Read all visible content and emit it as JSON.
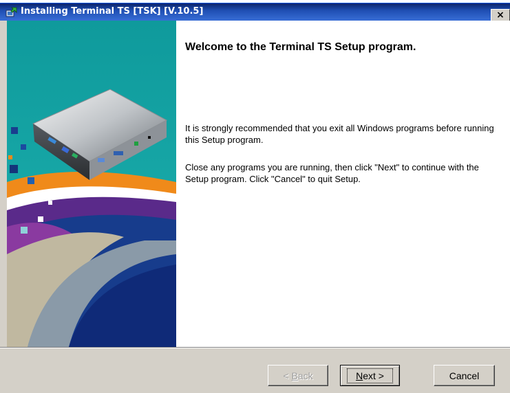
{
  "window": {
    "title": "Installing Terminal TS [TSK] [V.10.5]",
    "close_glyph": "×",
    "icon": "installer-icon"
  },
  "content": {
    "heading": "Welcome to the Terminal TS Setup program.",
    "paragraph1": "It is strongly recommended that you exit all Windows programs before running this Setup program.",
    "paragraph2": "Close any programs you are running, then click \"Next\" to continue with the Setup program. Click \"Cancel\" to quit Setup."
  },
  "buttons": {
    "back_prefix": "< ",
    "back_mnemonic": "B",
    "back_rest": "ack",
    "next_mnemonic": "N",
    "next_rest": "ext >",
    "cancel_label": "Cancel"
  },
  "colors": {
    "titlebar": "#0a246a",
    "dialog_face": "#d4d0c8",
    "side_teal": "#16a3a5",
    "side_navy": "#0c2a7a"
  }
}
